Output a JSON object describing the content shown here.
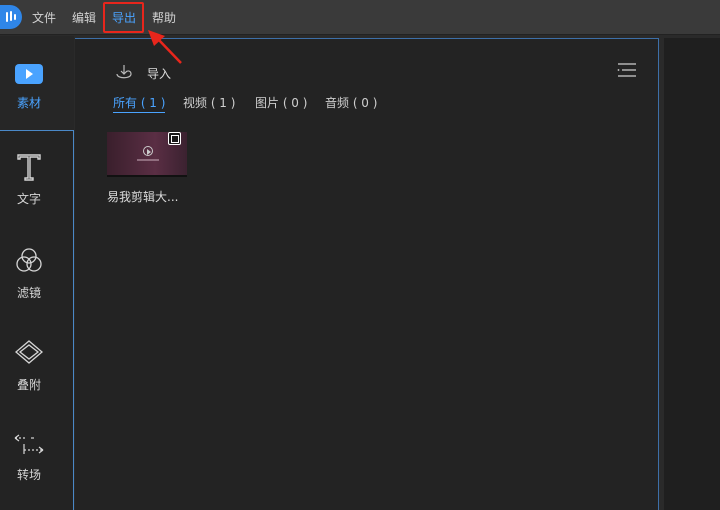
{
  "menubar": {
    "items": [
      {
        "label": "文件"
      },
      {
        "label": "编辑"
      },
      {
        "label": "导出"
      },
      {
        "label": "帮助"
      }
    ],
    "highlight_color": "#e8261c"
  },
  "sidebar": {
    "tools": [
      {
        "label": "素材",
        "icon": "media-icon"
      },
      {
        "label": "文字",
        "icon": "text-icon"
      },
      {
        "label": "滤镜",
        "icon": "filter-icon"
      },
      {
        "label": "叠附",
        "icon": "overlay-icon"
      },
      {
        "label": "转场",
        "icon": "transition-icon"
      }
    ]
  },
  "library": {
    "import_label": "导入",
    "filters": [
      {
        "label": "所有 ( 1 )"
      },
      {
        "label": "视频 ( 1 )"
      },
      {
        "label": "图片 ( 0 )"
      },
      {
        "label": "音频 ( 0 )"
      }
    ],
    "items": [
      {
        "name": "易我剪辑大..."
      }
    ]
  },
  "colors": {
    "accent": "#4aa3ff",
    "background": "#232323"
  }
}
